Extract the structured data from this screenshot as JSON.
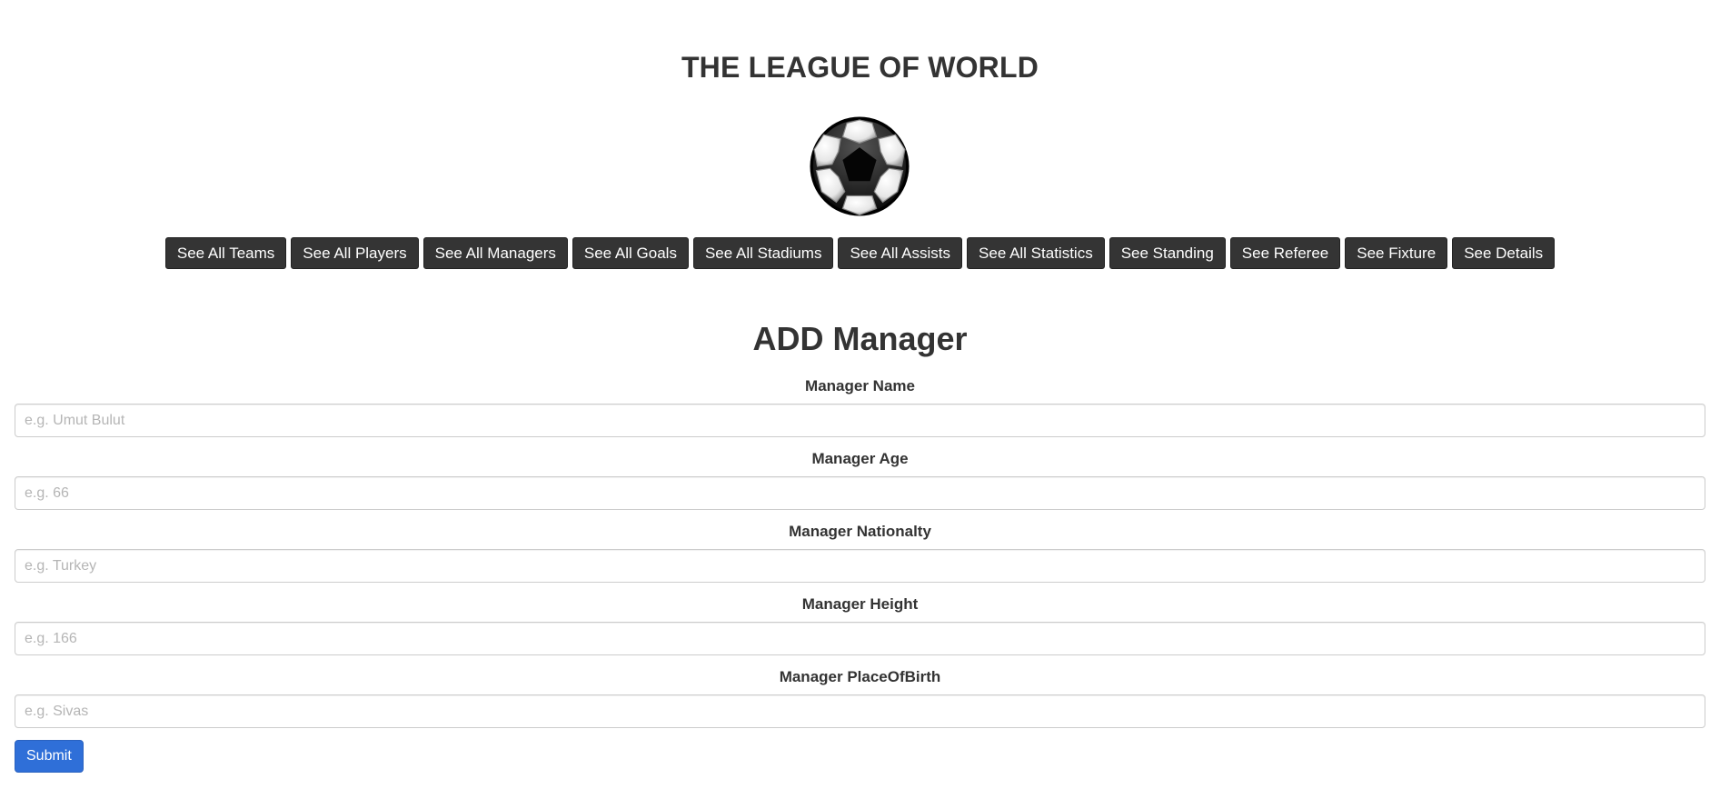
{
  "header": {
    "title": "THE LEAGUE OF WORLD",
    "logo_icon": "soccer-ball-icon"
  },
  "nav": {
    "buttons": [
      "See All Teams",
      "See All Players",
      "See All Managers",
      "See All Goals",
      "See All Stadiums",
      "See All Assists",
      "See All Statistics",
      "See Standing",
      "See Referee",
      "See Fixture",
      "See Details"
    ]
  },
  "form": {
    "title": "ADD Manager",
    "fields": [
      {
        "label": "Manager Name",
        "value": "",
        "placeholder": "e.g. Umut Bulut"
      },
      {
        "label": "Manager Age",
        "value": "",
        "placeholder": "e.g. 66"
      },
      {
        "label": "Manager Nationalty",
        "value": "",
        "placeholder": "e.g. Turkey"
      },
      {
        "label": "Manager Height",
        "value": "",
        "placeholder": "e.g. 166"
      },
      {
        "label": "Manager PlaceOfBirth",
        "value": "",
        "placeholder": "e.g. Sivas"
      }
    ],
    "submit_label": "Submit"
  },
  "colors": {
    "nav_button_bg": "#343434",
    "submit_bg": "#2f6fd8",
    "text": "#333333"
  }
}
